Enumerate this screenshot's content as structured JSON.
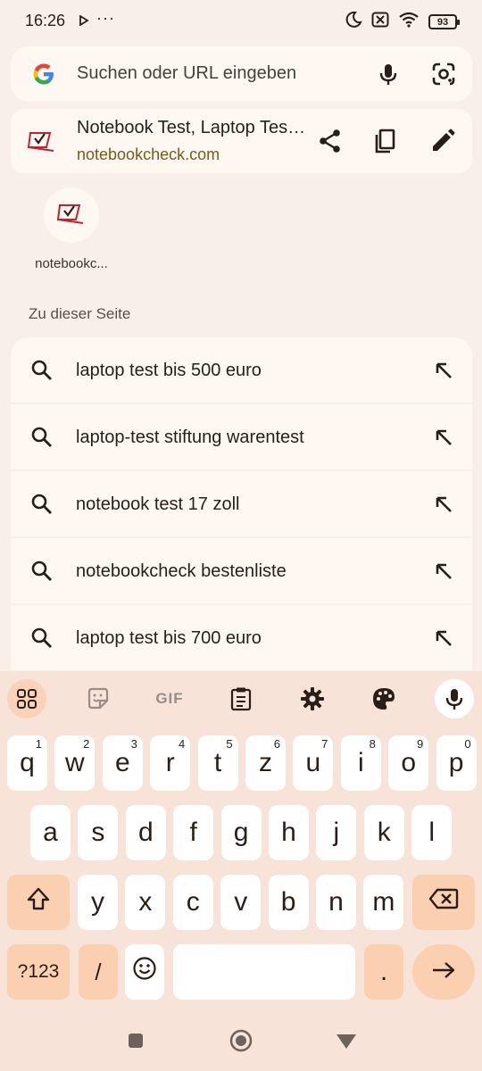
{
  "status_bar": {
    "time": "16:26",
    "dots": "···",
    "battery": "93"
  },
  "omnibox": {
    "placeholder": "Suchen oder URL eingeben",
    "icons": [
      "google-g-icon",
      "microphone-icon",
      "google-lens-icon"
    ]
  },
  "current_page": {
    "title": "Notebook Test, Laptop Test und News",
    "url": "notebookcheck.com",
    "actions": [
      "share-icon",
      "copy-icon",
      "edit-icon"
    ]
  },
  "tiles": [
    {
      "label": "notebookc..."
    }
  ],
  "section_title": "Zu dieser Seite",
  "suggestions": [
    {
      "text": "laptop test bis 500 euro"
    },
    {
      "text": "laptop-test stiftung warentest"
    },
    {
      "text": "notebook test 17 zoll"
    },
    {
      "text": "notebookcheck bestenliste"
    },
    {
      "text": "laptop test bis 700 euro"
    }
  ],
  "keyboard": {
    "toolbar": {
      "gif_label": "GIF",
      "icons": [
        "apps-grid-icon",
        "sticker-icon",
        "gif-icon",
        "clipboard-icon",
        "settings-gear-icon",
        "palette-icon",
        "microphone-icon"
      ]
    },
    "row1": [
      {
        "k": "q",
        "h": "1"
      },
      {
        "k": "w",
        "h": "2"
      },
      {
        "k": "e",
        "h": "3"
      },
      {
        "k": "r",
        "h": "4"
      },
      {
        "k": "t",
        "h": "5"
      },
      {
        "k": "z",
        "h": "6"
      },
      {
        "k": "u",
        "h": "7"
      },
      {
        "k": "i",
        "h": "8"
      },
      {
        "k": "o",
        "h": "9"
      },
      {
        "k": "p",
        "h": "0"
      }
    ],
    "row2": [
      "a",
      "s",
      "d",
      "f",
      "g",
      "h",
      "j",
      "k",
      "l"
    ],
    "row3": [
      "y",
      "x",
      "c",
      "v",
      "b",
      "n",
      "m"
    ],
    "symbols_label": "?123",
    "slash_label": "/",
    "period_label": ".",
    "space_label": ""
  },
  "colors": {
    "background": "#f8efe9",
    "surface": "#fff7f2",
    "keyboard_bg": "#f7e3d8",
    "accent_key": "#fbd0b1",
    "url_color": "#7a5a16"
  }
}
